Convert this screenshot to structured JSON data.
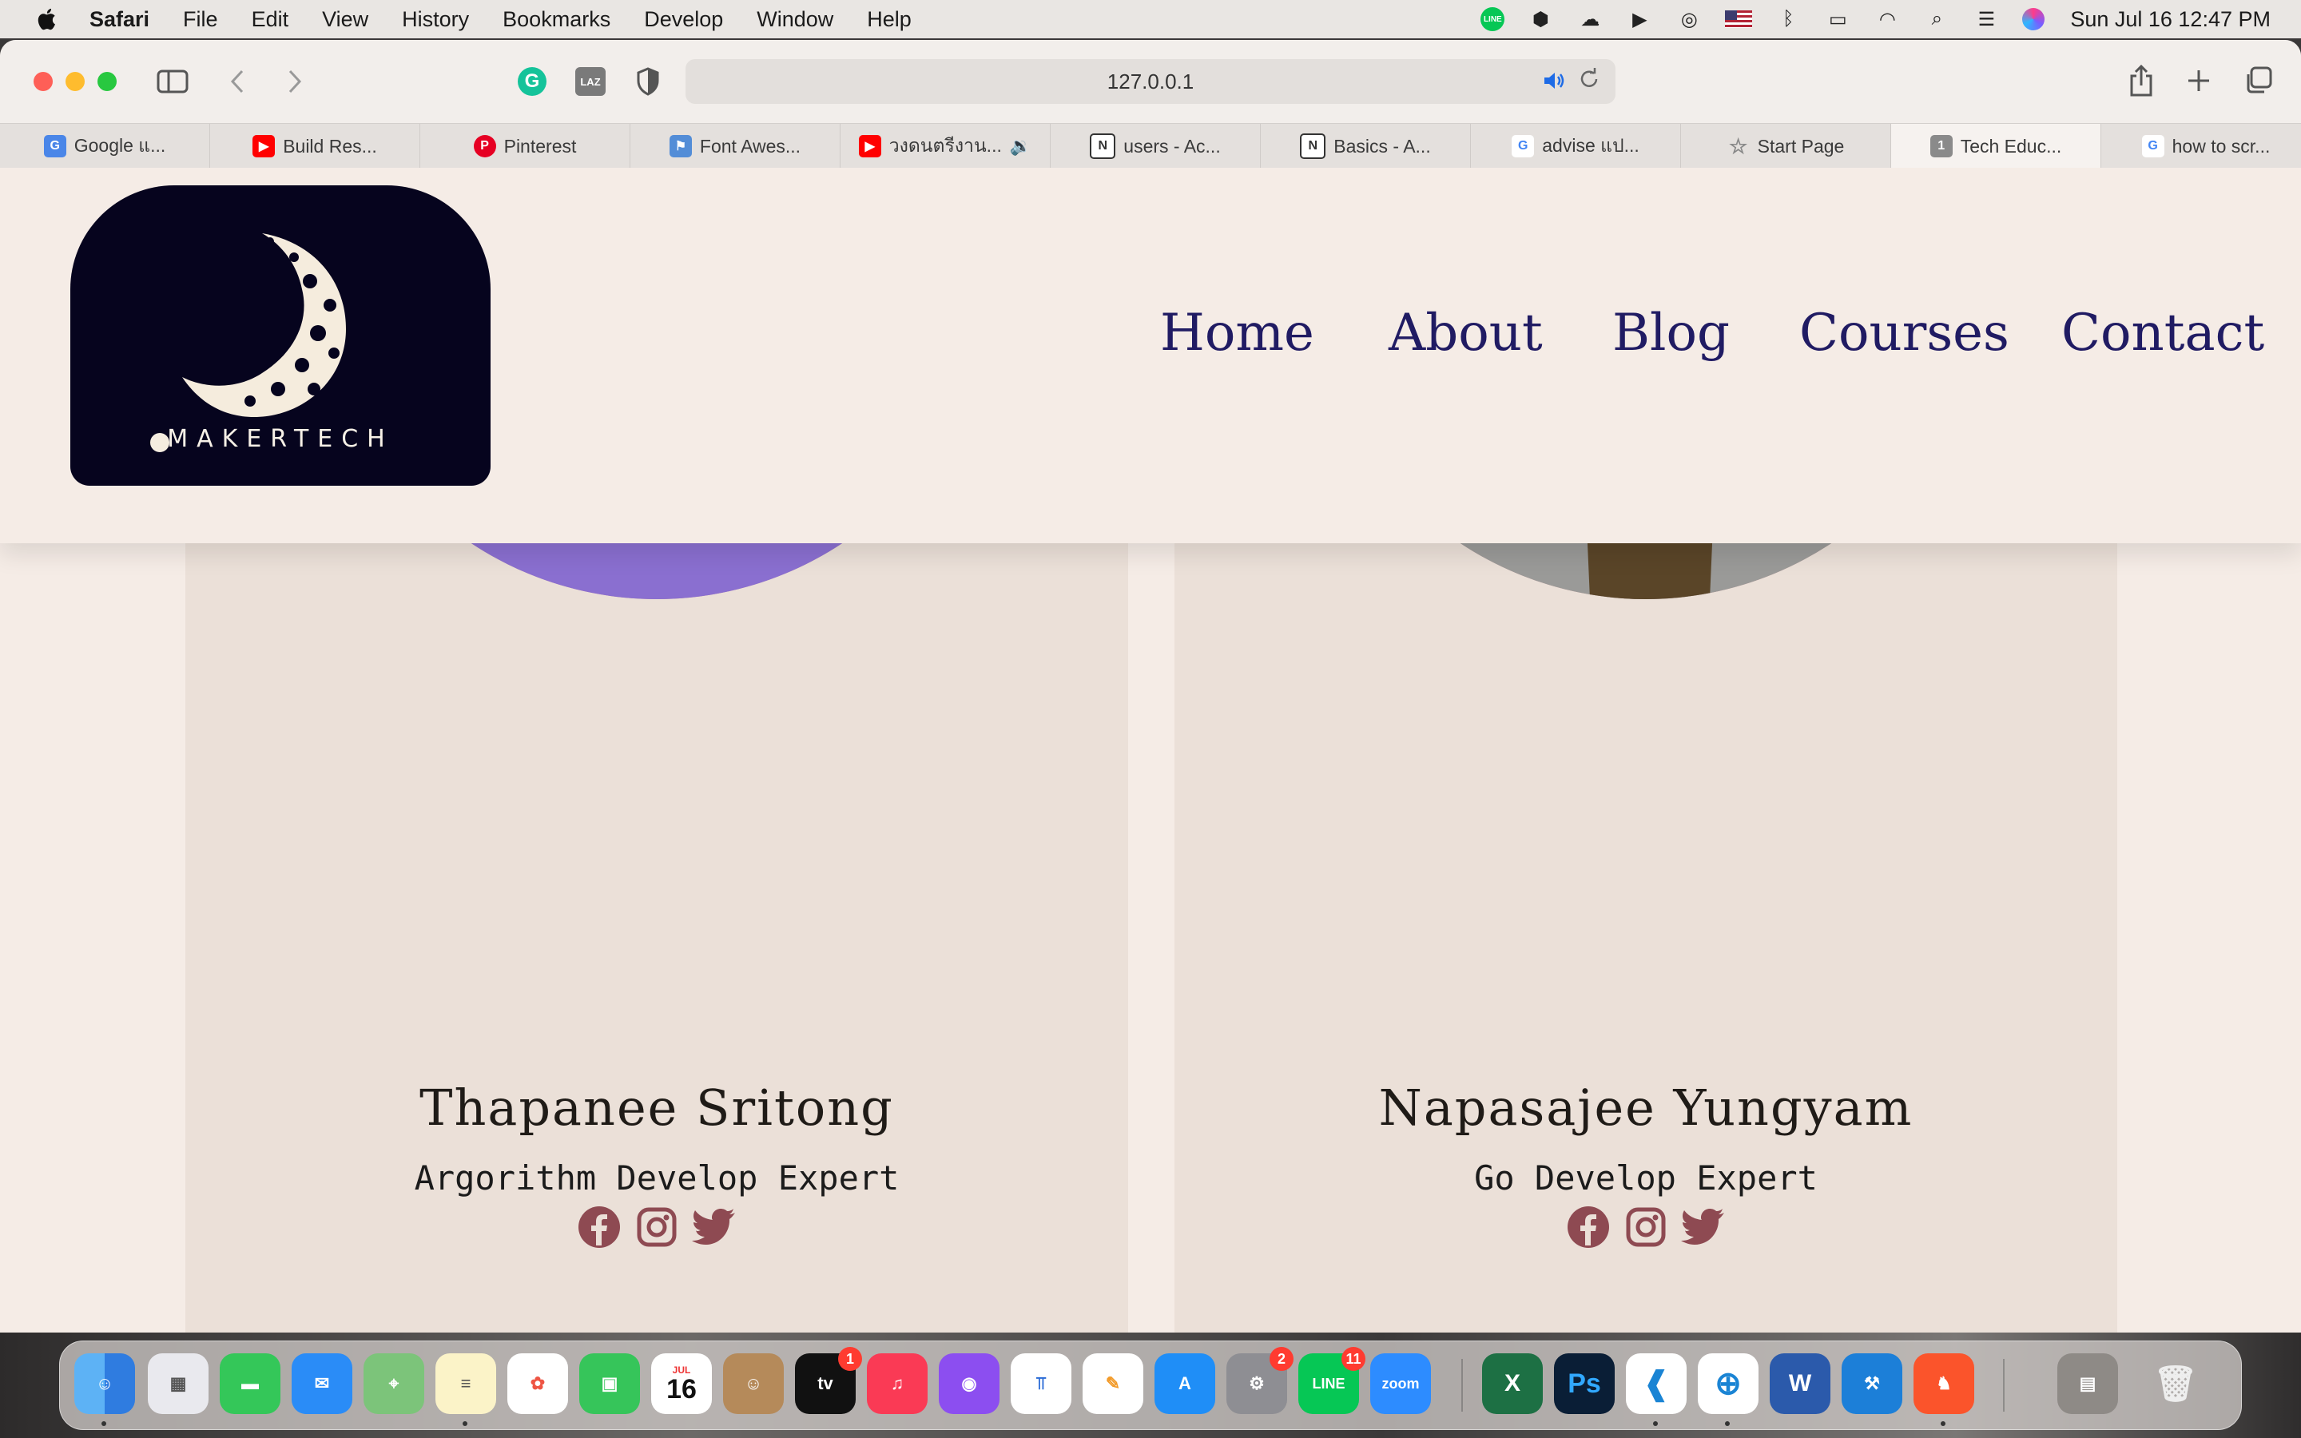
{
  "menubar": {
    "app_name": "Safari",
    "items": [
      "File",
      "Edit",
      "View",
      "History",
      "Bookmarks",
      "Develop",
      "Window",
      "Help"
    ],
    "clock": "Sun Jul 16  12:47 PM",
    "line_label": "LINE"
  },
  "browser": {
    "url": "127.0.0.1",
    "extension_g": "G",
    "extension_laz": "LAZ",
    "tabs": [
      {
        "label": "Google แ...",
        "icon": "google-translate-icon",
        "color": "#4a86e8"
      },
      {
        "label": "Build Res...",
        "icon": "youtube-icon",
        "color": "#ff0000"
      },
      {
        "label": "Pinterest",
        "icon": "pinterest-icon",
        "color": "#e60023"
      },
      {
        "label": "Font Awes...",
        "icon": "font-awesome-flag-icon",
        "color": "#538dd7"
      },
      {
        "label": "วงดนตรีงาน...",
        "icon": "youtube-icon",
        "color": "#ff0000"
      },
      {
        "label": "users - Ac...",
        "icon": "notion-icon",
        "color": "#333333"
      },
      {
        "label": "Basics - A...",
        "icon": "notion-icon",
        "color": "#333333"
      },
      {
        "label": "advise แป...",
        "icon": "google-icon",
        "color": "#4285f4"
      },
      {
        "label": "Start Page",
        "icon": "star-icon",
        "color": "#888888"
      },
      {
        "label": "Tech Educ...",
        "icon": "tab-number-icon",
        "color": "#8a8a8a",
        "badge": "1"
      },
      {
        "label": "how to scr...",
        "icon": "google-icon",
        "color": "#4285f4"
      }
    ]
  },
  "site": {
    "logo_text": "MAKERTECH",
    "nav": {
      "home": "Home",
      "about": "About",
      "blog": "Blog",
      "courses": "Courses",
      "contact": "Contact"
    },
    "members": [
      {
        "name": "Thapanee Sritong",
        "role": "Argorithm Develop Expert"
      },
      {
        "name": "Napasajee Yungyam",
        "role": "Go Develop Expert"
      }
    ],
    "social_icons": [
      "facebook-icon",
      "instagram-icon",
      "twitter-icon"
    ],
    "colors": {
      "nav": "#201b63",
      "social": "#8e4a52",
      "logo_bg": "#06041e",
      "card": "#ebe0d8",
      "page": "#f5ece6"
    }
  },
  "dock": {
    "calendar_month": "JUL",
    "calendar_day": "16",
    "tv_label": "tv",
    "tv_badge": "1",
    "settings_badge": "2",
    "line_badge": "11",
    "line_label": "LINE",
    "zoom_label": "zoom",
    "ps_label": "Ps",
    "word_label": "W",
    "excel_label": "X",
    "apps": [
      "Finder",
      "Launchpad",
      "Messages",
      "Mail",
      "Maps",
      "Notes",
      "Photos",
      "FaceTime",
      "Calendar",
      "Contacts",
      "TV",
      "Music",
      "Podcasts",
      "Keynote",
      "Pages",
      "App Store",
      "System Settings",
      "LINE",
      "Zoom",
      "Excel",
      "Photoshop",
      "VS Code",
      "Safari",
      "Word",
      "Xcode Tools",
      "Brave",
      "Downloads",
      "Trash"
    ]
  }
}
